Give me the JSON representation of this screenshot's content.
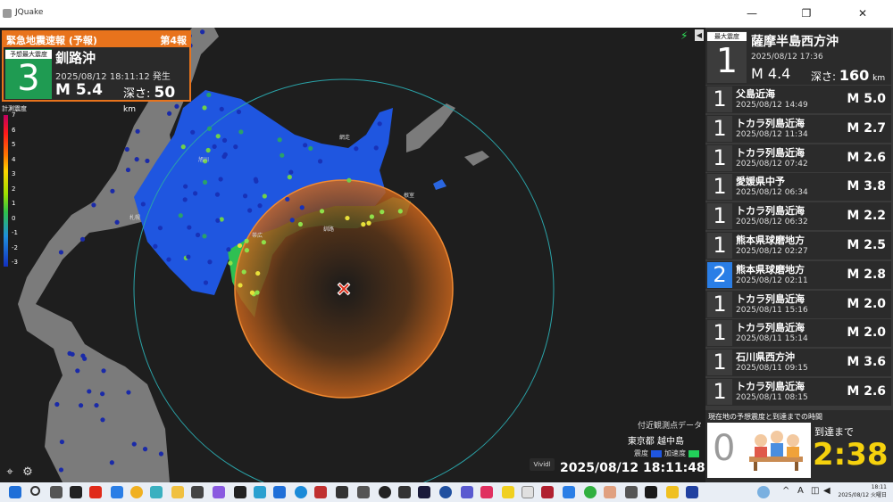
{
  "window": {
    "title": "JQuake",
    "minimize": "—",
    "restore": "❐",
    "close": "✕"
  },
  "eew": {
    "header": "緊急地震速報 (予報)",
    "report_no": "第4報",
    "max_int_label": "予想最大震度",
    "max_int": "3",
    "place": "釧路沖",
    "time": "2025/08/12 18:11:12 発生",
    "magnitude": "M 5.4",
    "depth_label": "深さ:",
    "depth_value": "50",
    "depth_unit": "km",
    "color": "#e8731c"
  },
  "legend": {
    "title": "計測震度",
    "ticks": [
      "7",
      "6",
      "5",
      "4",
      "3",
      "2",
      "1",
      "0",
      "-1",
      "-2",
      "-3"
    ]
  },
  "map": {
    "labels": [
      "網走",
      "旭川",
      "帯広",
      "釧路",
      "根室",
      "札幌"
    ],
    "epicenter_icon": "epicenter-cross-icon"
  },
  "station": {
    "header": "付近観測点データ",
    "place": "東京都 越中島",
    "legend_intensity": "震度",
    "legend_accel": "加速度",
    "intensity_color": "#1f56e0",
    "accel_color": "#22d15a"
  },
  "vivid": "Vividl",
  "clock": "2025/08/12 18:11:48",
  "latest": {
    "label": "最大震度",
    "intensity": "1",
    "place": "薩摩半島西方沖",
    "time": "2025/08/12 17:36",
    "magnitude": "M 4.4",
    "depth_label": "深さ:",
    "depth_value": "160",
    "depth_unit": "km"
  },
  "history": [
    {
      "intensity": "1",
      "place": "父島近海",
      "time": "2025/08/12 14:49",
      "magnitude": "M 5.0"
    },
    {
      "intensity": "1",
      "place": "トカラ列島近海",
      "time": "2025/08/12 11:34",
      "magnitude": "M 2.7"
    },
    {
      "intensity": "1",
      "place": "トカラ列島近海",
      "time": "2025/08/12 07:42",
      "magnitude": "M 2.6"
    },
    {
      "intensity": "1",
      "place": "愛媛県中予",
      "time": "2025/08/12 06:34",
      "magnitude": "M 3.8"
    },
    {
      "intensity": "1",
      "place": "トカラ列島近海",
      "time": "2025/08/12 06:32",
      "magnitude": "M 2.2"
    },
    {
      "intensity": "1",
      "place": "熊本県球磨地方",
      "time": "2025/08/12 02:27",
      "magnitude": "M 2.5"
    },
    {
      "intensity": "2",
      "place": "熊本県球磨地方",
      "time": "2025/08/12 02:11",
      "magnitude": "M 2.8"
    },
    {
      "intensity": "1",
      "place": "トカラ列島近海",
      "time": "2025/08/11 15:16",
      "magnitude": "M 2.0"
    },
    {
      "intensity": "1",
      "place": "トカラ列島近海",
      "time": "2025/08/11 15:14",
      "magnitude": "M 2.0"
    },
    {
      "intensity": "1",
      "place": "石川県西方沖",
      "time": "2025/08/11 09:15",
      "magnitude": "M 3.6"
    },
    {
      "intensity": "1",
      "place": "トカラ列島近海",
      "time": "2025/08/11 08:15",
      "magnitude": "M 2.6"
    }
  ],
  "arrival": {
    "header": "現在地の予想震度と到達までの時間",
    "intensity": "0",
    "until_label": "到達まで",
    "countdown": "2:38"
  },
  "taskbar": {
    "lang": "A",
    "time": "18:11",
    "date": "2025/08/12 火曜日"
  }
}
